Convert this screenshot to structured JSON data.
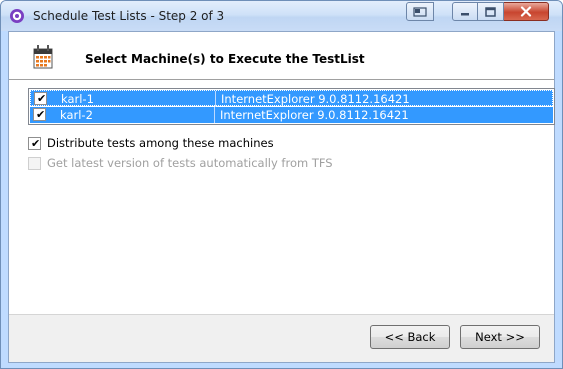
{
  "window": {
    "title": "Schedule Test Lists - Step 2 of 3",
    "icons": [
      "app-gear-icon",
      "restore-icon",
      "minimize-icon",
      "maximize-icon",
      "close-icon"
    ]
  },
  "header": {
    "title": "Select Machine(s) to Execute the TestList",
    "icon": "calendar-icon"
  },
  "machines": [
    {
      "name": "karl-1",
      "browser": "InternetExplorer 9.0.8112.16421",
      "checked": true,
      "selected": true
    },
    {
      "name": "karl-2",
      "browser": "InternetExplorer 9.0.8112.16421",
      "checked": true,
      "selected": true
    }
  ],
  "options": {
    "distribute": {
      "label": "Distribute tests among these machines",
      "checked": true,
      "enabled": true
    },
    "latest_tfs": {
      "label": "Get latest version of tests automatically from TFS",
      "checked": false,
      "enabled": false
    }
  },
  "buttons": {
    "back": "<< Back",
    "next": "Next >>"
  },
  "colors": {
    "selection": "#3399ff",
    "titlebar": "#c9dcf6",
    "close_button": "#c8452f"
  }
}
